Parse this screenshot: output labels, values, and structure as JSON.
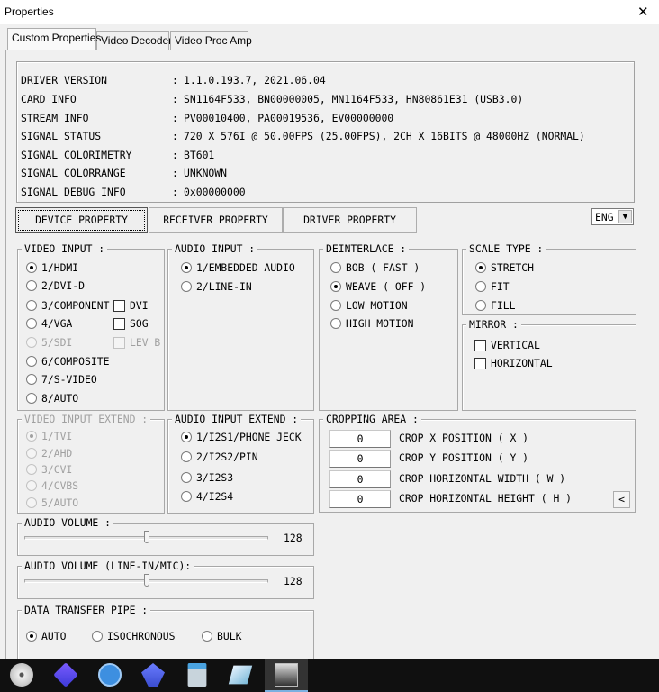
{
  "window": {
    "title": "Properties",
    "close": "✕"
  },
  "tabs": [
    "Custom Properties",
    "Video Decoder",
    "Video Proc Amp"
  ],
  "info": [
    {
      "label": "DRIVER VERSION",
      "value": "1.1.0.193.7, 2021.06.04"
    },
    {
      "label": "CARD INFO",
      "value": "SN1164F533, BN00000005, MN1164F533, HN80861E31 (USB3.0)"
    },
    {
      "label": "STREAM INFO",
      "value": "PV00010400, PA00019536, EV00000000"
    },
    {
      "label": "SIGNAL STATUS",
      "value": "720 X 576I @ 50.00FPS (25.00FPS), 2CH X 16BITS @ 48000HZ (NORMAL)"
    },
    {
      "label": "SIGNAL COLORIMETRY",
      "value": "BT601"
    },
    {
      "label": "SIGNAL COLORRANGE",
      "value": "UNKNOWN"
    },
    {
      "label": "SIGNAL DEBUG INFO",
      "value": "0x00000000"
    }
  ],
  "colon": ":",
  "prop_buttons": [
    "DEVICE PROPERTY",
    "RECEIVER PROPERTY",
    "DRIVER PROPERTY"
  ],
  "language": {
    "value": "ENG"
  },
  "video_input": {
    "title": "VIDEO INPUT :",
    "options": [
      "1/HDMI",
      "2/DVI-D",
      "3/COMPONENT",
      "4/VGA",
      "5/SDI",
      "6/COMPOSITE",
      "7/S-VIDEO",
      "8/AUTO"
    ],
    "selected": 0,
    "checks": [
      "DVI",
      "SOG",
      "LEV B"
    ]
  },
  "audio_input": {
    "title": "AUDIO INPUT :",
    "options": [
      "1/EMBEDDED AUDIO",
      "2/LINE-IN"
    ],
    "selected": 0
  },
  "deinterlace": {
    "title": "DEINTERLACE :",
    "options": [
      "BOB ( FAST )",
      "WEAVE ( OFF )",
      "LOW MOTION",
      "HIGH MOTION"
    ],
    "selected": 1
  },
  "scale_type": {
    "title": "SCALE TYPE :",
    "options": [
      "STRETCH",
      "FIT",
      "FILL"
    ],
    "selected": 0
  },
  "mirror": {
    "title": "MIRROR :",
    "options": [
      "VERTICAL",
      "HORIZONTAL"
    ]
  },
  "video_input_extend": {
    "title": "VIDEO INPUT EXTEND :",
    "options": [
      "1/TVI",
      "2/AHD",
      "3/CVI",
      "4/CVBS",
      "5/AUTO"
    ],
    "selected": 0
  },
  "audio_input_extend": {
    "title": "AUDIO INPUT EXTEND :",
    "options": [
      "1/I2S1/PHONE JECK",
      "2/I2S2/PIN",
      "3/I2S3",
      "4/I2S4"
    ],
    "selected": 0
  },
  "cropping": {
    "title": "CROPPING AREA :",
    "rows": [
      {
        "value": "0",
        "label": "CROP X POSITION ( X )"
      },
      {
        "value": "0",
        "label": "CROP Y POSITION ( Y )"
      },
      {
        "value": "0",
        "label": "CROP HORIZONTAL WIDTH ( W )"
      },
      {
        "value": "0",
        "label": "CROP HORIZONTAL HEIGHT ( H )"
      }
    ],
    "collapse": "<"
  },
  "audio_volume": {
    "title": "AUDIO VOLUME :",
    "value": "128",
    "max": 255
  },
  "audio_volume_line": {
    "title": "AUDIO VOLUME (LINE-IN/MIC):",
    "value": "128",
    "max": 255
  },
  "transfer": {
    "title": "DATA TRANSFER PIPE :",
    "options": [
      "AUTO",
      "ISOCHRONOUS",
      "BULK"
    ],
    "selected": 0
  },
  "taskbar": [
    "disc-app-icon",
    "media-player-icon",
    "qbittorrent-icon",
    "bird-app-icon",
    "calculator-icon",
    "notepad-icon",
    "amarec-icon"
  ]
}
